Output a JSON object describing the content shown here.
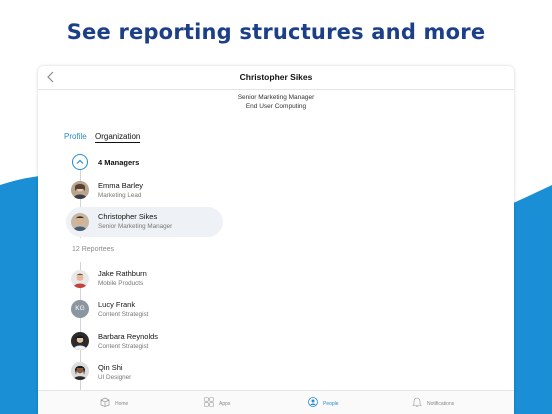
{
  "headline": "See reporting structures and more",
  "header": {
    "title": "Christopher Sikes",
    "job_title": "Senior Marketing Manager",
    "department": "End User Computing"
  },
  "tabs": [
    {
      "label": "Profile",
      "active": false
    },
    {
      "label": "Organization",
      "active": true
    }
  ],
  "managers": {
    "label": "4 Managers",
    "items": [
      {
        "name": "Emma Barley",
        "role": "Marketing Lead",
        "avatar": "photo"
      },
      {
        "name": "Christopher Sikes",
        "role": "Senior Marketing Manager",
        "avatar": "photo",
        "selected": true
      }
    ]
  },
  "reportees": {
    "label": "12 Reportees",
    "items": [
      {
        "name": "Jake Rathburn",
        "role": "Mobile Products",
        "avatar": "photo"
      },
      {
        "name": "Lucy Frank",
        "role": "Content Strategist",
        "avatar": "initials",
        "initials": "KG"
      },
      {
        "name": "Barbara Reynolds",
        "role": "Content Strategist",
        "avatar": "photo"
      },
      {
        "name": "Qin Shi",
        "role": "UI Designer",
        "avatar": "photo"
      }
    ]
  },
  "tabbar": [
    {
      "label": "Home",
      "icon": "home-icon",
      "active": false
    },
    {
      "label": "Apps",
      "icon": "apps-icon",
      "active": false
    },
    {
      "label": "People",
      "icon": "people-icon",
      "active": true
    },
    {
      "label": "Notifications",
      "icon": "bell-icon",
      "active": false
    }
  ],
  "colors": {
    "accent": "#2a8bd4",
    "headline": "#1c3f87",
    "wave": "#1a8fd6"
  }
}
